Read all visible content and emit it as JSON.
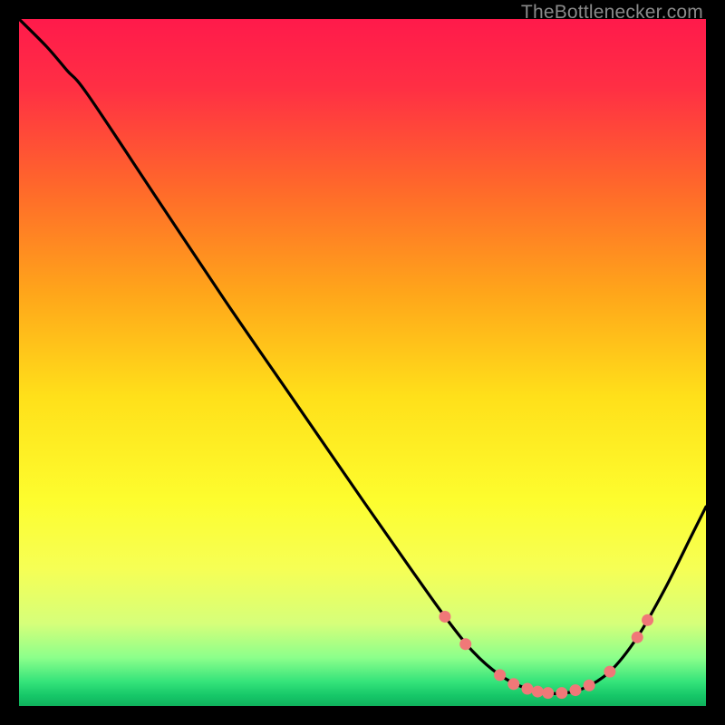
{
  "attribution": "TheBottlenecker.com",
  "chart_data": {
    "type": "line",
    "title": "",
    "xlabel": "",
    "ylabel": "",
    "xlim": [
      0,
      100
    ],
    "ylim": [
      0,
      100
    ],
    "gradient_stops": [
      {
        "offset": 0,
        "color": "#ff1a4b"
      },
      {
        "offset": 0.1,
        "color": "#ff2f44"
      },
      {
        "offset": 0.25,
        "color": "#ff6a2a"
      },
      {
        "offset": 0.4,
        "color": "#ffa61a"
      },
      {
        "offset": 0.55,
        "color": "#ffe01a"
      },
      {
        "offset": 0.7,
        "color": "#fdfd2e"
      },
      {
        "offset": 0.8,
        "color": "#f6ff55"
      },
      {
        "offset": 0.88,
        "color": "#d6ff7a"
      },
      {
        "offset": 0.93,
        "color": "#8bff8b"
      },
      {
        "offset": 0.965,
        "color": "#34e37a"
      },
      {
        "offset": 0.985,
        "color": "#16c768"
      },
      {
        "offset": 1.0,
        "color": "#0fb15c"
      }
    ],
    "curve": [
      {
        "x": 0,
        "y": 100
      },
      {
        "x": 4,
        "y": 96
      },
      {
        "x": 7,
        "y": 92.5
      },
      {
        "x": 10,
        "y": 89
      },
      {
        "x": 20,
        "y": 74
      },
      {
        "x": 30,
        "y": 59
      },
      {
        "x": 40,
        "y": 44.5
      },
      {
        "x": 50,
        "y": 30
      },
      {
        "x": 57,
        "y": 20
      },
      {
        "x": 62,
        "y": 13
      },
      {
        "x": 66,
        "y": 8
      },
      {
        "x": 70,
        "y": 4.5
      },
      {
        "x": 74,
        "y": 2.5
      },
      {
        "x": 78,
        "y": 1.8
      },
      {
        "x": 82,
        "y": 2.5
      },
      {
        "x": 86,
        "y": 5
      },
      {
        "x": 90,
        "y": 10
      },
      {
        "x": 94,
        "y": 17
      },
      {
        "x": 98,
        "y": 25
      },
      {
        "x": 100,
        "y": 29
      }
    ],
    "marker_points": [
      {
        "x": 62,
        "y": 13
      },
      {
        "x": 65,
        "y": 9
      },
      {
        "x": 70,
        "y": 4.5
      },
      {
        "x": 72,
        "y": 3.2
      },
      {
        "x": 74,
        "y": 2.5
      },
      {
        "x": 75.5,
        "y": 2.1
      },
      {
        "x": 77,
        "y": 1.9
      },
      {
        "x": 79,
        "y": 1.9
      },
      {
        "x": 81,
        "y": 2.3
      },
      {
        "x": 83,
        "y": 3.0
      },
      {
        "x": 86,
        "y": 5.0
      },
      {
        "x": 90,
        "y": 10
      },
      {
        "x": 91.5,
        "y": 12.5
      }
    ],
    "marker_color": "#f07878",
    "curve_color": "#000000",
    "curve_width": 3.2,
    "marker_radius": 6.5
  }
}
